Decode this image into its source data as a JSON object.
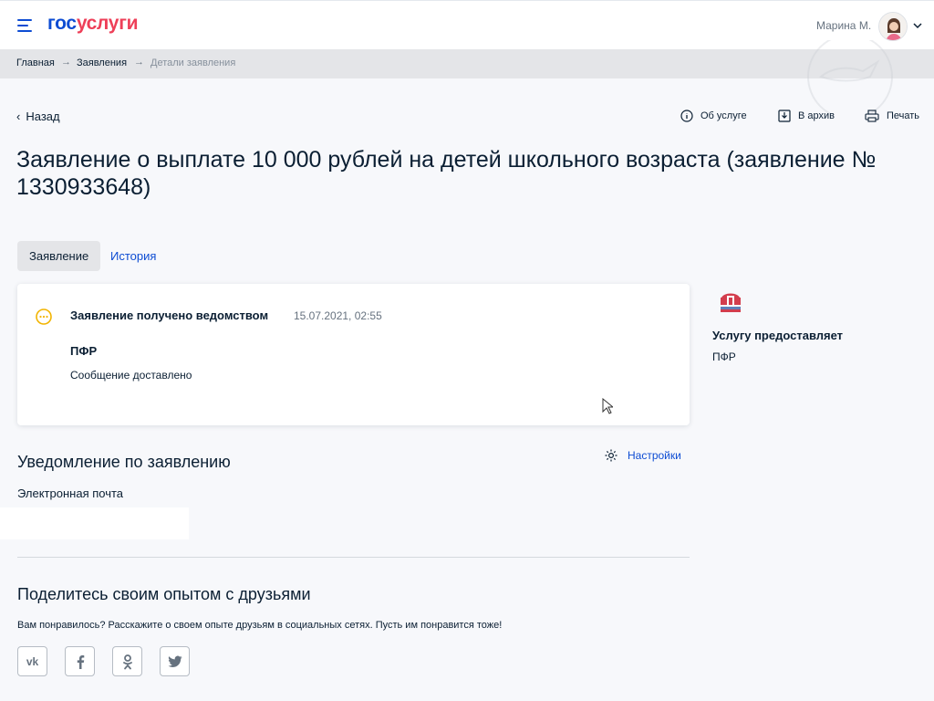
{
  "header": {
    "logo_part1": "гос",
    "logo_part2": "услуги",
    "user_name": "Марина М."
  },
  "breadcrumbs": {
    "home": "Главная",
    "applications": "Заявления",
    "current": "Детали заявления"
  },
  "nav": {
    "back": "Назад",
    "back_icon": "chevron-left-icon"
  },
  "actions": {
    "about": "Об услуге",
    "archive": "В архив",
    "print": "Печать"
  },
  "page": {
    "title": "Заявление о выплате 10 000 рублей на детей школьного возраста (заявление № 1330933648)"
  },
  "tabs": [
    {
      "label": "Заявление",
      "active": true
    },
    {
      "label": "История",
      "active": false
    }
  ],
  "status_card": {
    "status": "Заявление получено ведомством",
    "date": "15.07.2021, 02:55",
    "department": "ПФР",
    "message": "Сообщение доставлено",
    "status_color": "#f2b400"
  },
  "provider": {
    "caption": "Услугу предоставляет",
    "name": "ПФР"
  },
  "notifications": {
    "title": "Уведомление по заявлению",
    "settings": "Настройки",
    "channel": "Электронная почта"
  },
  "share": {
    "title": "Поделитесь своим опытом с друзьями",
    "text": "Вам понравилось? Расскажите о своем опыте друзьям в социальных сетях. Пусть им понравится тоже!",
    "networks": [
      "vk-icon",
      "facebook-icon",
      "odnoklassniki-icon",
      "twitter-icon"
    ]
  },
  "colors": {
    "primary": "#0d4cd3",
    "brand_red": "#ee3f58",
    "text": "#0b1f33",
    "muted": "#66727f",
    "background": "#f7f8fb"
  }
}
